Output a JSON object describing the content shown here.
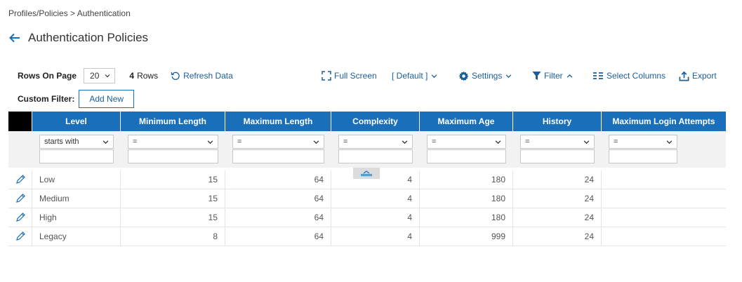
{
  "breadcrumb": "Profiles/Policies > Authentication",
  "page_title": "Authentication Policies",
  "toolbar": {
    "rows_on_page_label": "Rows On Page",
    "rows_on_page_value": "20",
    "row_count": "4",
    "row_count_label": "Rows",
    "refresh_label": "Refresh Data",
    "full_screen_label": "Full Screen",
    "view_label": "[ Default ]",
    "settings_label": "Settings",
    "filter_label": "Filter",
    "select_columns_label": "Select Columns",
    "export_label": "Export"
  },
  "custom_filter": {
    "label": "Custom Filter:",
    "add_new_label": "Add New"
  },
  "table": {
    "columns": [
      "Level",
      "Minimum Length",
      "Maximum Length",
      "Complexity",
      "Maximum Age",
      "History",
      "Maximum Login Attempts"
    ],
    "filters": [
      "starts with",
      "=",
      "=",
      "=",
      "=",
      "=",
      "="
    ],
    "rows": [
      {
        "level": "Low",
        "min_length": "15",
        "max_length": "64",
        "complexity": "4",
        "max_age": "180",
        "history": "24",
        "max_login_attempts": ""
      },
      {
        "level": "Medium",
        "min_length": "15",
        "max_length": "64",
        "complexity": "4",
        "max_age": "180",
        "history": "24",
        "max_login_attempts": ""
      },
      {
        "level": "High",
        "min_length": "15",
        "max_length": "64",
        "complexity": "4",
        "max_age": "180",
        "history": "24",
        "max_login_attempts": ""
      },
      {
        "level": "Legacy",
        "min_length": "8",
        "max_length": "64",
        "complexity": "4",
        "max_age": "999",
        "history": "24",
        "max_login_attempts": ""
      }
    ]
  },
  "colors": {
    "accent": "#1a6fba",
    "link": "#1a5e9a",
    "header_first": "#000000"
  },
  "icons": [
    "back-arrow-icon",
    "chevron-down-icon",
    "refresh-icon",
    "full-screen-icon",
    "gear-icon",
    "filter-icon",
    "chevron-up-icon",
    "columns-icon",
    "export-icon",
    "pencil-icon",
    "collapse-icon"
  ]
}
